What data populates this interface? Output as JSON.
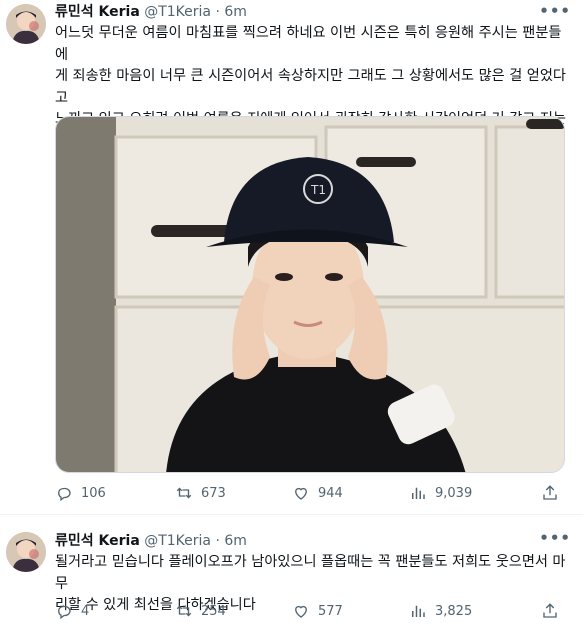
{
  "tweets": [
    {
      "display_name": "류민석 Keria",
      "handle": "@T1Keria",
      "separator": "·",
      "time": "6m",
      "text": "어느덧 무더운 여름이 마침표를 찍으려 하네요 이번 시즌은 특히 응원해 주시는 팬분들에\n게 죄송한 마음이 너무 큰 시즌이어서 속상하지만 그래도 그 상황에서도 많은 걸 얻었다고\n느끼고 있고 오히려 이번 여름은 저에게 있어서 굉장히 감사한 시간이었던 거 같고 저는 제\n가 앞으로 더 나은 선수가",
      "replies": "106",
      "retweets": "673",
      "likes": "944",
      "views": "9,039"
    },
    {
      "display_name": "류민석 Keria",
      "handle": "@T1Keria",
      "separator": "·",
      "time": "6m",
      "text": "될거라고 믿습니다 플레이오프가 남아있으니 플옵때는 꼭 팬분들도 저희도 웃으면서 마무\n리할 수 있게 최선을 다하겠습니다",
      "replies": "4",
      "retweets": "254",
      "likes": "577",
      "views": "3,825"
    }
  ],
  "icons": {
    "avatar": "profile-photo",
    "more": "more-dots-icon",
    "reply": "reply-icon",
    "retweet": "retweet-icon",
    "like": "heart-icon",
    "views": "views-bar-icon",
    "share": "share-icon"
  },
  "colors": {
    "text": "#0f1419",
    "secondary": "#536471",
    "border": "#eff3f4"
  }
}
